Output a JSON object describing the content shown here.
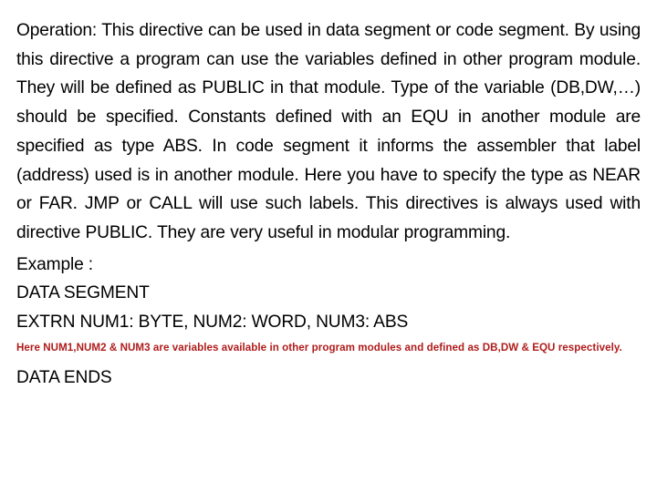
{
  "slide": {
    "background_color": "#ffffff",
    "body_text_color": "#000000",
    "note_text_color": "#B01C1C",
    "paragraph": "Operation: This directive can be used in data segment or code segment. By using this directive a program can use the variables defined in other program module. They will be defined as PUBLIC in that module. Type of the variable (DB,DW,…) should be specified. Constants defined with an EQU in another module are specified as type ABS.   In code segment it informs the assembler that label (address) used is in another module. Here you have to specify the type as NEAR or FAR. JMP or CALL will use such labels. This directives is always used with directive PUBLIC. They are very useful in modular programming.",
    "example_label": "Example :",
    "code_lines": [
      "DATA SEGMENT",
      "EXTRN NUM1: BYTE, NUM2: WORD, NUM3: ABS"
    ],
    "note": "Here NUM1,NUM2 & NUM3 are variables available in other program modules and defined as DB,DW & EQU respectively.",
    "closing_line": "DATA ENDS"
  }
}
